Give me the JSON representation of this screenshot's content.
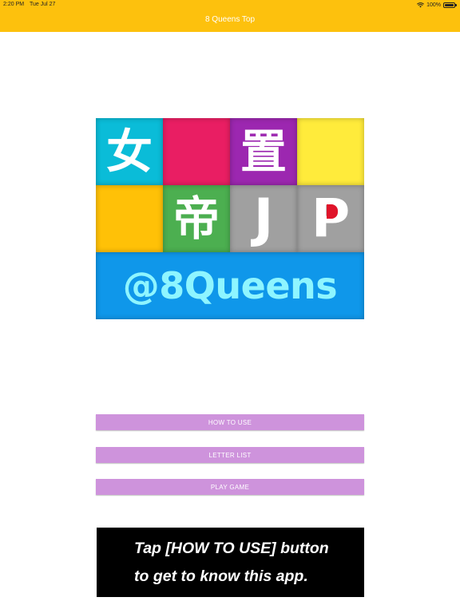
{
  "status_bar": {
    "time": "2:20 PM",
    "date": "Tue Jul 27",
    "battery": "100%"
  },
  "nav": {
    "title": "8 Queens Top",
    "background_color": "#fdc10d"
  },
  "logo": {
    "cells": [
      {
        "text": "女",
        "color": "#0abcd8"
      },
      {
        "text": "",
        "color": "#e91e63"
      },
      {
        "text": "置",
        "color": "#9c27b0"
      },
      {
        "text": "",
        "color": "#ffeb3b"
      },
      {
        "text": "",
        "color": "#ffc107"
      },
      {
        "text": "帝",
        "color": "#4caf50"
      },
      {
        "text": "J",
        "color": "#a0a0a0"
      },
      {
        "text": "P",
        "color": "#a0a0a0"
      }
    ],
    "banner_text": "@8Queens",
    "banner_color": "#0f97ea",
    "banner_text_color": "#8ef5ff",
    "p_dot_color": "#e0142a"
  },
  "menu": {
    "how_to_use": "HOW TO USE",
    "letter_list": "LETTER LIST",
    "play_game": "PLAY GAME",
    "button_color": "#ce93dc"
  },
  "hint": {
    "line1": "Tap [HOW TO USE] button",
    "line2": "to get to know this app."
  }
}
